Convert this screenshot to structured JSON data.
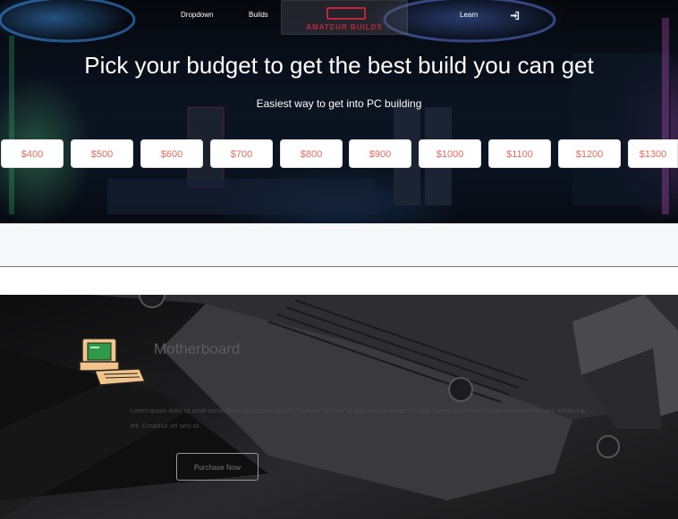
{
  "nav": {
    "items": [
      "Dropdown",
      "Builds",
      "Learn"
    ],
    "logo_text": "AMATEUR BUILDS",
    "login_icon": "sign-in-icon"
  },
  "hero": {
    "title": "Pick your budget to get the best build you can get",
    "subtitle": "Easiest way to get into PC building",
    "budgets": [
      "$400",
      "$500",
      "$600",
      "$700",
      "$800",
      "$900",
      "$1000",
      "$1100",
      "$1200",
      "$1300"
    ]
  },
  "product": {
    "icon": "computer-icon",
    "heading": "Motherboard",
    "description": "Lorem ipsum dolor sit amet consectetur sed adipiscing elit. Curabitur vel sem sit dolor neque semper magna. Lorem ipsum dolor sit amet consectetur sed adipiscing elit. Curabitur vel sem sit.",
    "button_label": "Purchase Now"
  },
  "colors": {
    "budget_text": "#e26b5b",
    "logo": "#c0263a"
  }
}
